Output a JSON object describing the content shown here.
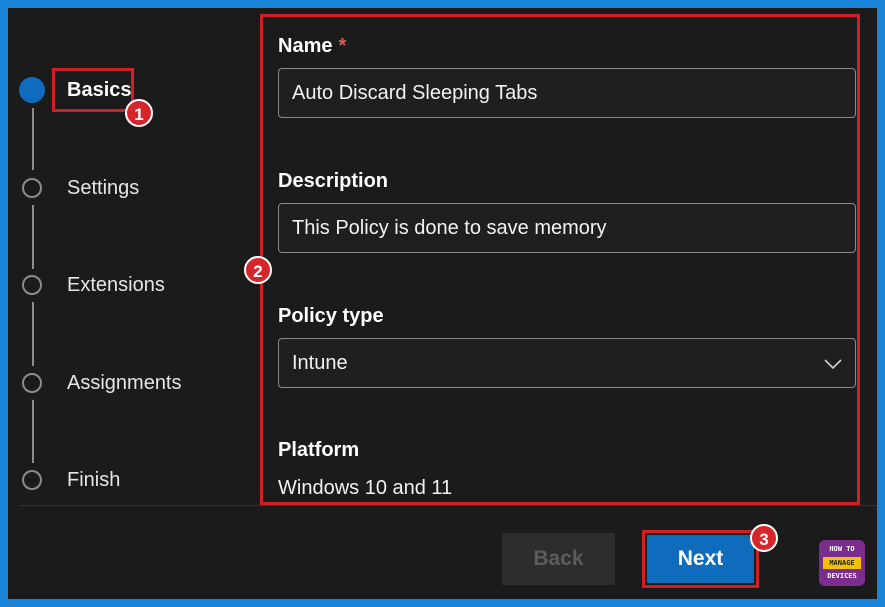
{
  "wizard": {
    "steps": [
      {
        "label": "Basics",
        "state": "active"
      },
      {
        "label": "Settings",
        "state": "pending"
      },
      {
        "label": "Extensions",
        "state": "pending"
      },
      {
        "label": "Assignments",
        "state": "pending"
      },
      {
        "label": "Finish",
        "state": "pending"
      }
    ]
  },
  "form": {
    "name_label": "Name",
    "required_mark": "*",
    "name_value": "Auto Discard Sleeping Tabs",
    "description_label": "Description",
    "description_value": "This Policy is done to save memory",
    "policy_type_label": "Policy type",
    "policy_type_value": "Intune",
    "platform_label": "Platform",
    "platform_value": "Windows 10 and 11"
  },
  "footer": {
    "back_label": "Back",
    "next_label": "Next"
  },
  "annotations": {
    "badge_1": "1",
    "badge_2": "2",
    "badge_3": "3"
  },
  "logo": {
    "line1": "HOW TO",
    "line2": "MANAGE",
    "line3": "DEVICES"
  },
  "colors": {
    "accent": "#0f6cbd",
    "highlight": "#d21f26",
    "page_border": "#1a84d8"
  }
}
